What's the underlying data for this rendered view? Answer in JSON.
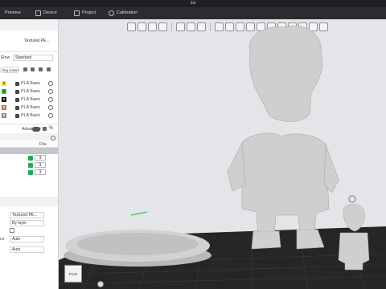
{
  "window": {
    "title": "1st"
  },
  "menu": {
    "preview": "Preview",
    "device": "Device",
    "project": "Project",
    "calibration": "Calibration"
  },
  "sidebar": {
    "plate_type": "Textured PE...",
    "flow_label": "Flow",
    "flow_value": "Standard",
    "ting_volumes": "ting volumes",
    "filaments": [
      {
        "slot": "2",
        "name": "PLA Basic",
        "color": "#f4e322"
      },
      {
        "slot": "4",
        "name": "PLA Basic",
        "color": "#29c04a"
      },
      {
        "slot": "1",
        "name": "PLA Basic",
        "color": "#161616"
      },
      {
        "slot": "3",
        "name": "PLA Basic",
        "color": "#c86a5c"
      },
      {
        "slot": "5",
        "name": "PLA Basic",
        "color": "#8a8a8a"
      }
    ],
    "advanced_label": "Advanced",
    "objects_header": "Fila",
    "object_filaments": [
      "3",
      "3",
      "3"
    ],
    "plate_value": "Textured PE...",
    "seq_value": "By layer",
    "ce_label": "ce",
    "auto_a": "Auto",
    "auto_b": "Auto"
  },
  "viewport": {
    "view_cube_label": "Front",
    "bed_color": "#2a2a2a",
    "model_color": "#cfcfcf"
  }
}
